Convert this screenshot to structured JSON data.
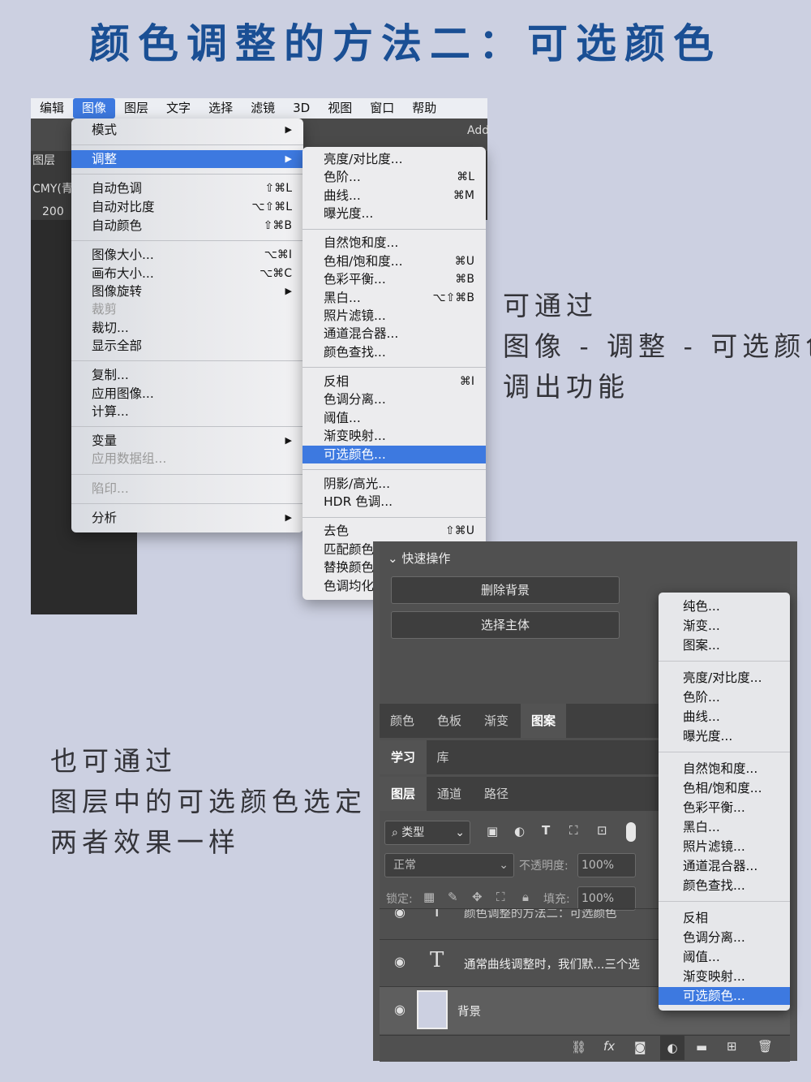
{
  "title": "颜色调整的方法二：可选颜色",
  "note_right": [
    "可通过",
    "图像 - 调整 - 可选颜色",
    "调出功能"
  ],
  "note_left": [
    "也可通过",
    "图层中的可选颜色选定",
    "两者效果一样"
  ],
  "menubar": [
    "编辑",
    "图像",
    "图层",
    "文字",
    "选择",
    "滤镜",
    "3D",
    "视图",
    "窗口",
    "帮助"
  ],
  "bg_labels": {
    "top_right": "Add",
    "layers": "图层",
    "cmy": "CMY(青...",
    "num": "200"
  },
  "image_menu": [
    {
      "label": "模式",
      "submenu": true
    },
    {
      "label": "调整",
      "submenu": true,
      "highlighted": true
    },
    {
      "label": "自动色调",
      "shortcut": "⇧⌘L"
    },
    {
      "label": "自动对比度",
      "shortcut": "⌥⇧⌘L"
    },
    {
      "label": "自动颜色",
      "shortcut": "⇧⌘B"
    },
    {
      "label": "图像大小...",
      "shortcut": "⌥⌘I"
    },
    {
      "label": "画布大小...",
      "shortcut": "⌥⌘C"
    },
    {
      "label": "图像旋转",
      "submenu": true
    },
    {
      "label": "裁剪",
      "disabled": true
    },
    {
      "label": "裁切..."
    },
    {
      "label": "显示全部"
    },
    {
      "label": "复制..."
    },
    {
      "label": "应用图像..."
    },
    {
      "label": "计算..."
    },
    {
      "label": "变量",
      "submenu": true
    },
    {
      "label": "应用数据组...",
      "disabled": true
    },
    {
      "label": "陷印...",
      "disabled": true
    },
    {
      "label": "分析",
      "submenu": true
    }
  ],
  "adjust_menu": [
    {
      "label": "亮度/对比度..."
    },
    {
      "label": "色阶...",
      "shortcut": "⌘L"
    },
    {
      "label": "曲线...",
      "shortcut": "⌘M"
    },
    {
      "label": "曝光度..."
    },
    {
      "label": "自然饱和度..."
    },
    {
      "label": "色相/饱和度...",
      "shortcut": "⌘U"
    },
    {
      "label": "色彩平衡...",
      "shortcut": "⌘B"
    },
    {
      "label": "黑白...",
      "shortcut": "⌥⇧⌘B"
    },
    {
      "label": "照片滤镜..."
    },
    {
      "label": "通道混合器..."
    },
    {
      "label": "颜色查找..."
    },
    {
      "label": "反相",
      "shortcut": "⌘I"
    },
    {
      "label": "色调分离..."
    },
    {
      "label": "阈值..."
    },
    {
      "label": "渐变映射..."
    },
    {
      "label": "可选颜色...",
      "highlighted": true
    },
    {
      "label": "阴影/高光..."
    },
    {
      "label": "HDR 色调..."
    },
    {
      "label": "去色",
      "shortcut": "⇧⌘U"
    },
    {
      "label": "匹配颜色"
    },
    {
      "label": "替换颜色"
    },
    {
      "label": "色调均化"
    }
  ],
  "layers_panel": {
    "quick_actions": "快速操作",
    "btn_remove_bg": "删除背景",
    "btn_select_subject": "选择主体",
    "tabs1": [
      "颜色",
      "色板",
      "渐变",
      "图案"
    ],
    "tabs2": [
      "学习",
      "库"
    ],
    "tabs3": [
      "图层",
      "通道",
      "路径"
    ],
    "filter": "类型",
    "blend_mode": "正常",
    "opacity_label": "不透明度:",
    "opacity_value": "100%",
    "lock_label": "锁定:",
    "fill_label": "填充:",
    "fill_value": "100%",
    "layer_text_partial": "颜色调整的方法二：可选颜色",
    "layer_text": "通常曲线调整时，我们默...三个选",
    "layer_bg": "背景"
  },
  "context_menu": [
    "纯色...",
    "渐变...",
    "图案...",
    "亮度/对比度...",
    "色阶...",
    "曲线...",
    "曝光度...",
    "自然饱和度...",
    "色相/饱和度...",
    "色彩平衡...",
    "黑白...",
    "照片滤镜...",
    "通道混合器...",
    "颜色查找...",
    "反相",
    "色调分离...",
    "阈值...",
    "渐变映射...",
    "可选颜色..."
  ],
  "colors": {
    "accent": "#3d79e0",
    "title": "#1a4f94",
    "background": "#ccd0e1"
  }
}
